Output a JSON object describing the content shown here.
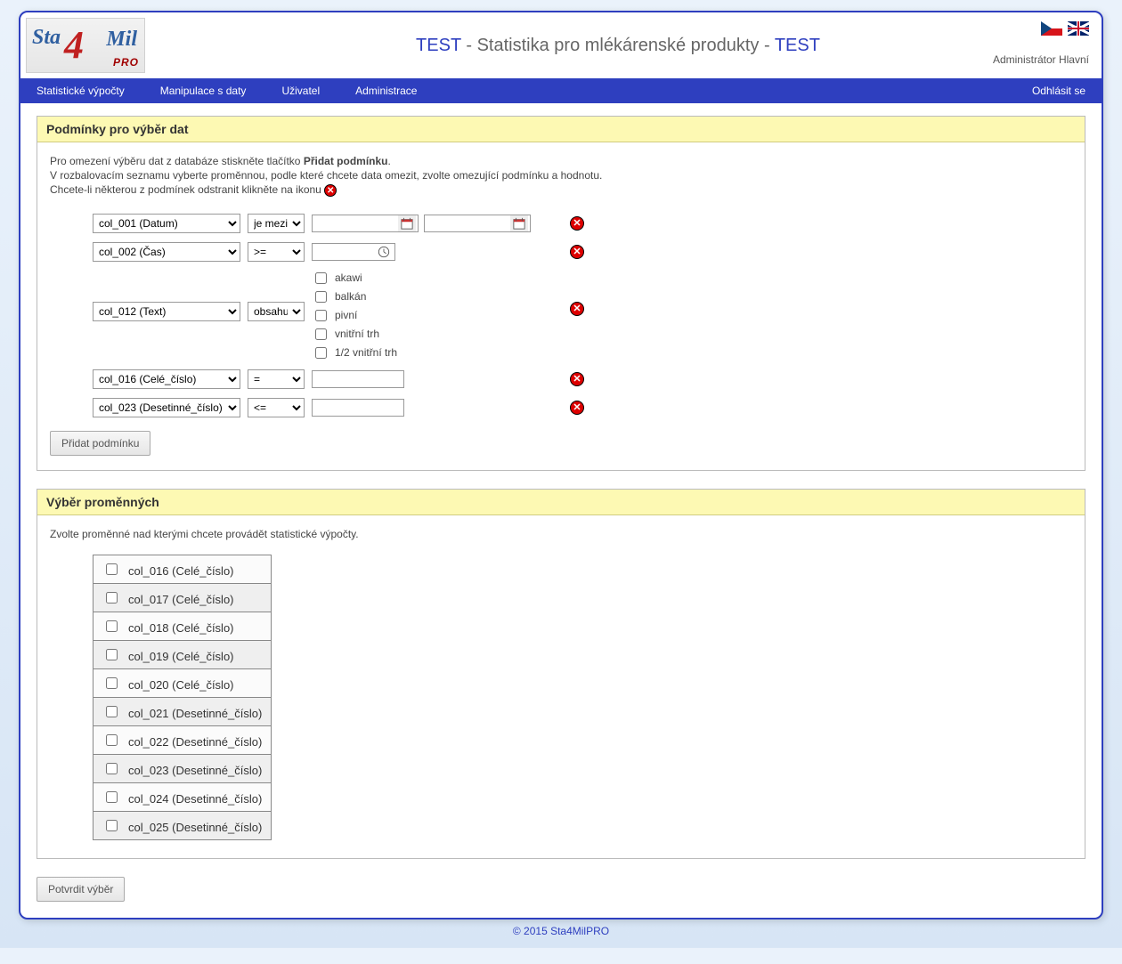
{
  "header": {
    "title_prefix": "TEST",
    "title_mid": " - Statistika pro mlékárenské produkty - ",
    "title_suffix": "TEST",
    "user_label": "Administrátor Hlavní",
    "logo": {
      "sta": "Sta",
      "four": "4",
      "mil": "Mil",
      "pro": "PRO"
    }
  },
  "nav": {
    "items": [
      "Statistické výpočty",
      "Manipulace s daty",
      "Uživatel",
      "Administrace"
    ],
    "logout": "Odhlásit se"
  },
  "panel_conditions": {
    "title": "Podmínky pro výběr dat",
    "intro_line1_a": "Pro omezení výběru dat z databáze stiskněte tlačítko ",
    "intro_line1_b": "Přidat podmínku",
    "intro_line1_c": ".",
    "intro_line2": "V rozbalovacím seznamu vyberte proměnnou, podle které chcete data omezit, zvolte omezující podmínku a hodnotu.",
    "intro_line3": "Chcete-li některou z podmínek odstranit klikněte na ikonu ",
    "rows": [
      {
        "col": "col_001 (Datum)",
        "op": "je mezi",
        "type": "date_range"
      },
      {
        "col": "col_002 (Čas)",
        "op": ">=",
        "type": "time"
      },
      {
        "col": "col_012 (Text)",
        "op": "obsahuje",
        "type": "checkboxes",
        "options": [
          "akawi",
          "balkán",
          "pivní",
          "vnitřní trh",
          "1/2 vnitřní trh"
        ]
      },
      {
        "col": "col_016 (Celé_číslo)",
        "op": "=",
        "type": "text"
      },
      {
        "col": "col_023 (Desetinné_číslo)",
        "op": "<=",
        "type": "text"
      }
    ],
    "add_button": "Přidat podmínku"
  },
  "panel_vars": {
    "title": "Výběr proměnných",
    "intro": "Zvolte proměnné nad kterými chcete provádět statistické výpočty.",
    "items": [
      "col_016 (Celé_číslo)",
      "col_017 (Celé_číslo)",
      "col_018 (Celé_číslo)",
      "col_019 (Celé_číslo)",
      "col_020 (Celé_číslo)",
      "col_021 (Desetinné_číslo)",
      "col_022 (Desetinné_číslo)",
      "col_023 (Desetinné_číslo)",
      "col_024 (Desetinné_číslo)",
      "col_025 (Desetinné_číslo)"
    ]
  },
  "confirm_button": "Potvrdit výběr",
  "footer": "© 2015 Sta4MilPRO"
}
